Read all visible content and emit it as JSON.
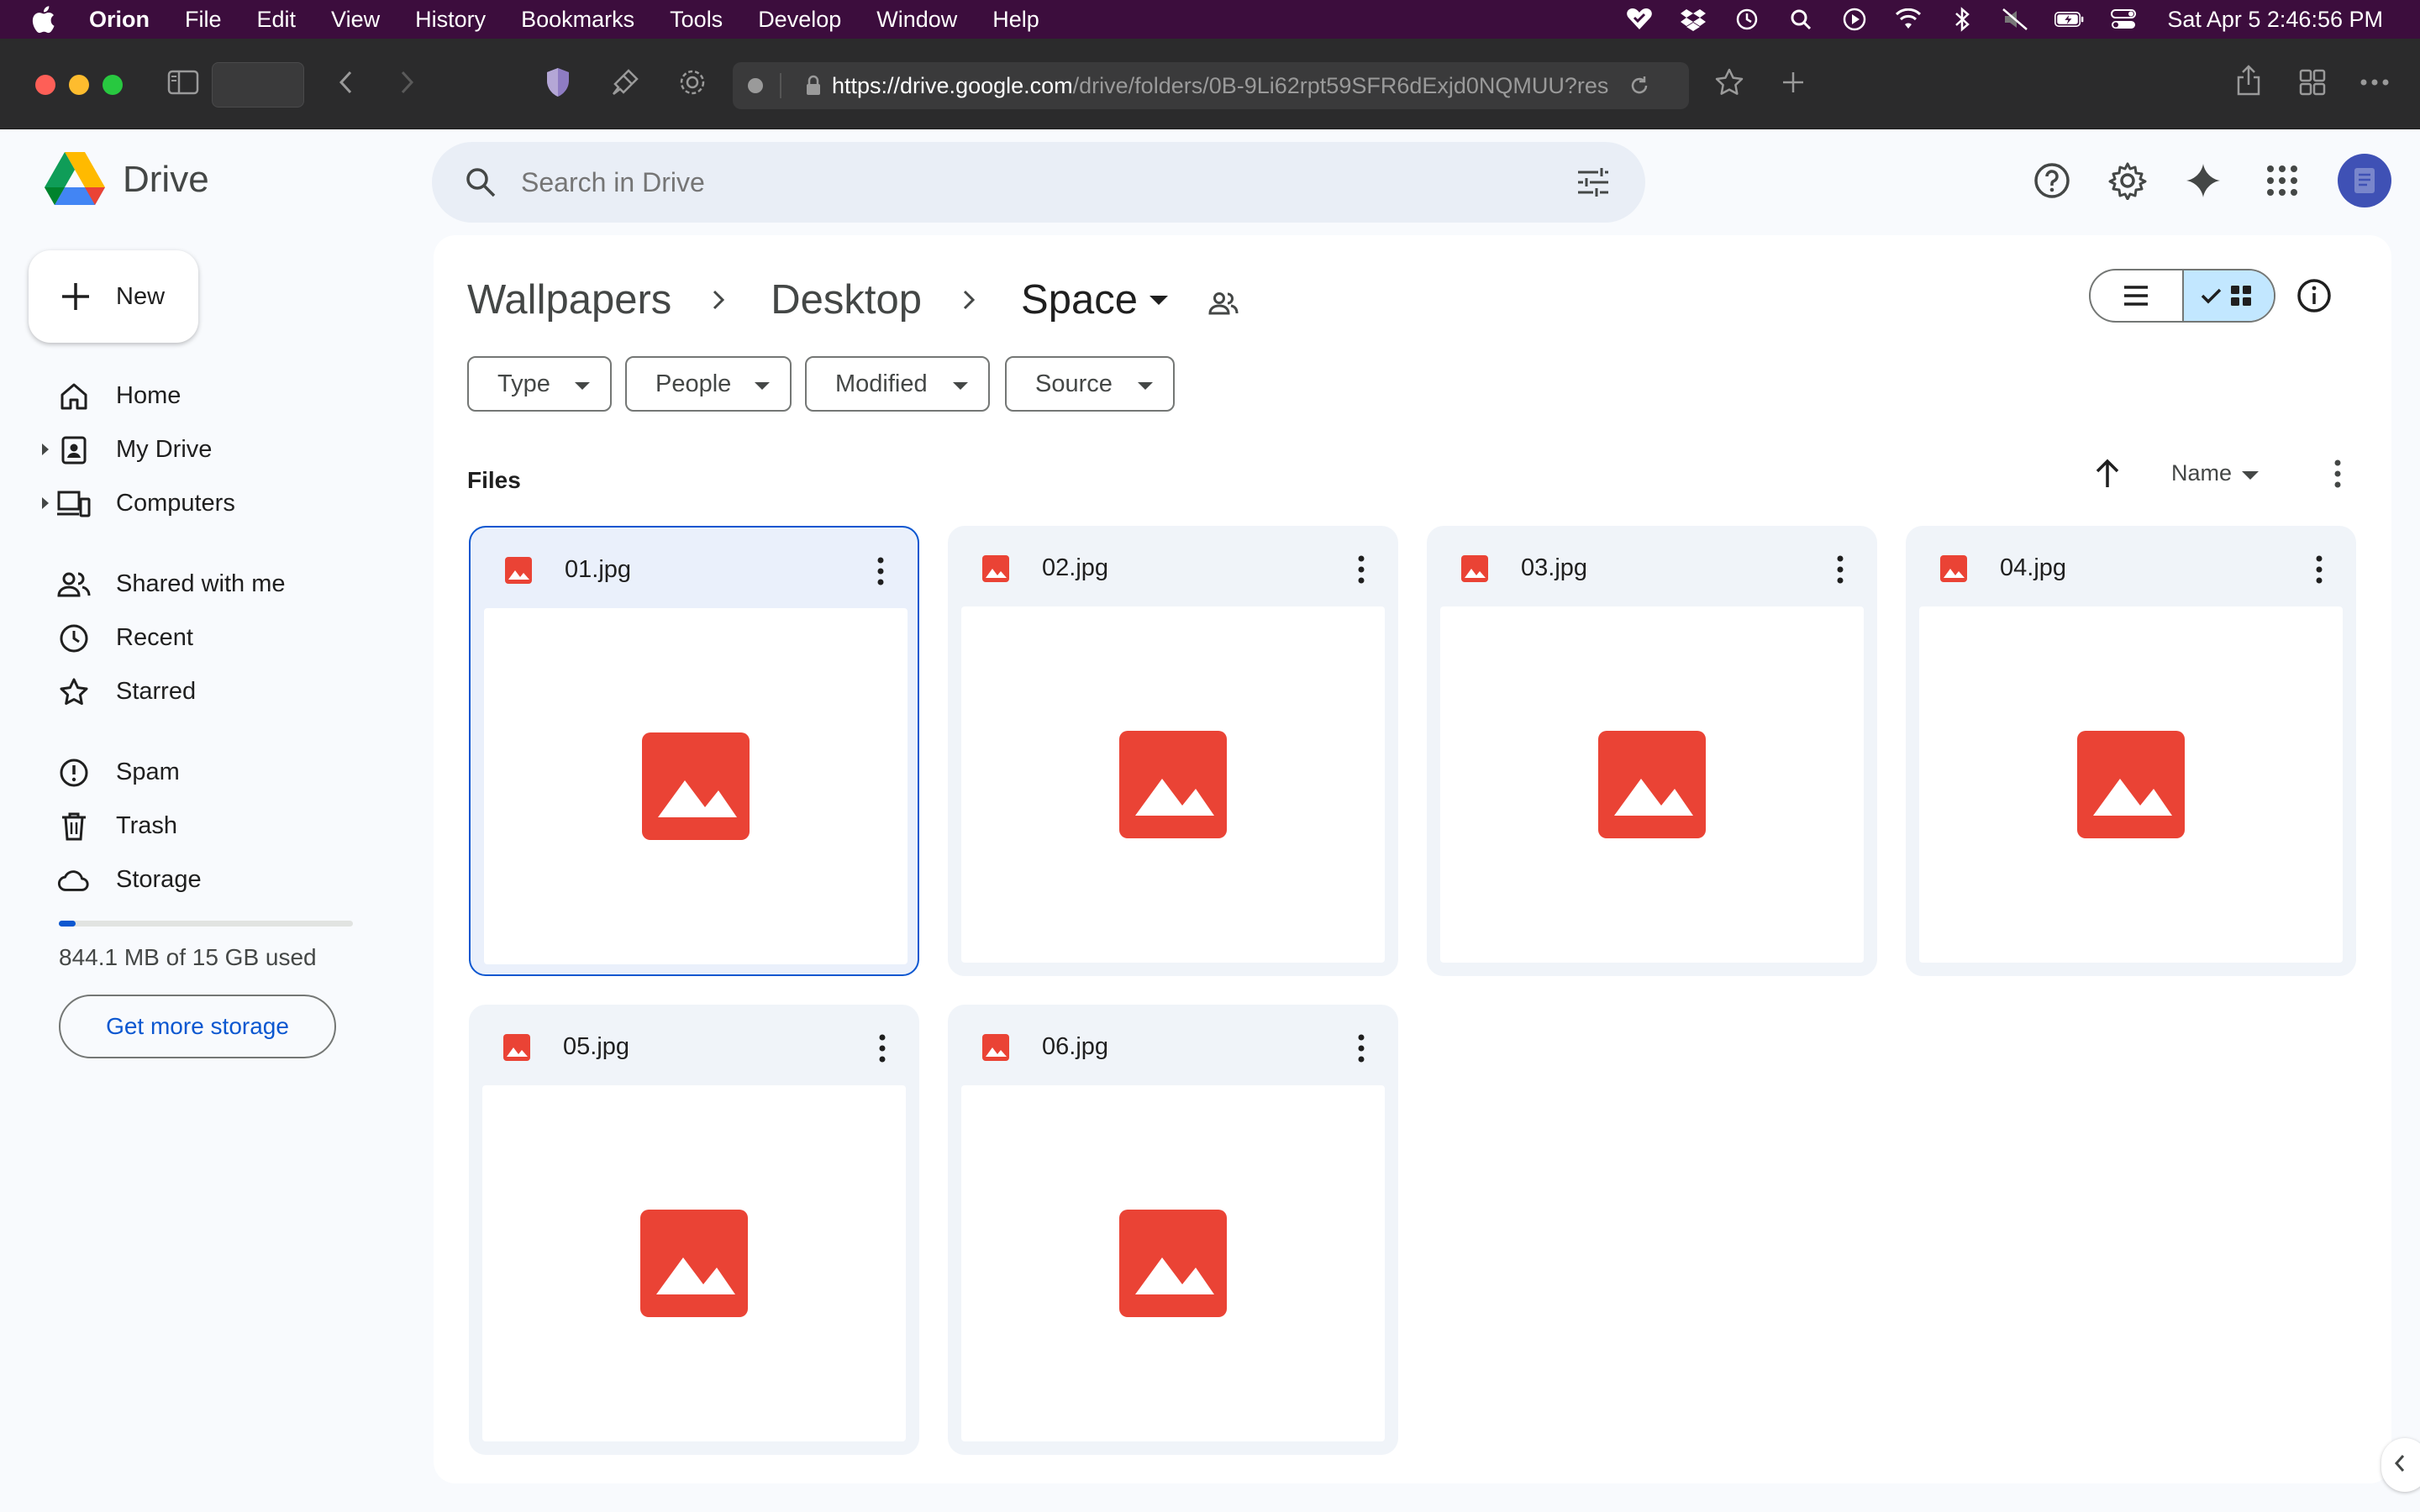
{
  "menubar": {
    "app": "Orion",
    "items": [
      "File",
      "Edit",
      "View",
      "History",
      "Bookmarks",
      "Tools",
      "Develop",
      "Window",
      "Help"
    ],
    "clock": "Sat Apr 5  2:46:56 PM",
    "status_icons": [
      "vpn-heart-icon",
      "dropbox-icon",
      "time-machine-icon",
      "spotlight-icon",
      "play-icon",
      "wifi-icon",
      "bluetooth-icon",
      "mute-icon",
      "battery-icon",
      "control-center-icon"
    ]
  },
  "browser": {
    "url_host": "https://drive.google.com",
    "url_path": "/drive/folders/0B-9Li62rpt59SFR6dExjd0NQMUU?res"
  },
  "drive": {
    "name": "Drive",
    "search_placeholder": "Search in Drive",
    "new_label": "New",
    "nav": {
      "home": "Home",
      "my_drive": "My Drive",
      "computers": "Computers",
      "shared": "Shared with me",
      "recent": "Recent",
      "starred": "Starred",
      "spam": "Spam",
      "trash": "Trash",
      "storage": "Storage"
    },
    "storage_used_text": "844.1 MB of 15 GB used",
    "storage_fraction": 0.056,
    "get_more_storage": "Get more storage"
  },
  "main": {
    "breadcrumb": [
      "Wallpapers",
      "Desktop",
      "Space"
    ],
    "filters": [
      "Type",
      "People",
      "Modified",
      "Source"
    ],
    "section_label": "Files",
    "sort_label": "Name",
    "files": [
      "01.jpg",
      "02.jpg",
      "03.jpg",
      "04.jpg",
      "05.jpg",
      "06.jpg"
    ],
    "selected_file": "01.jpg"
  },
  "colors": {
    "image_red": "#ea4335",
    "accent_blue": "#0b57d0",
    "toggle_on": "#c2e7ff",
    "menubar_bg": "#3c0d3d"
  }
}
